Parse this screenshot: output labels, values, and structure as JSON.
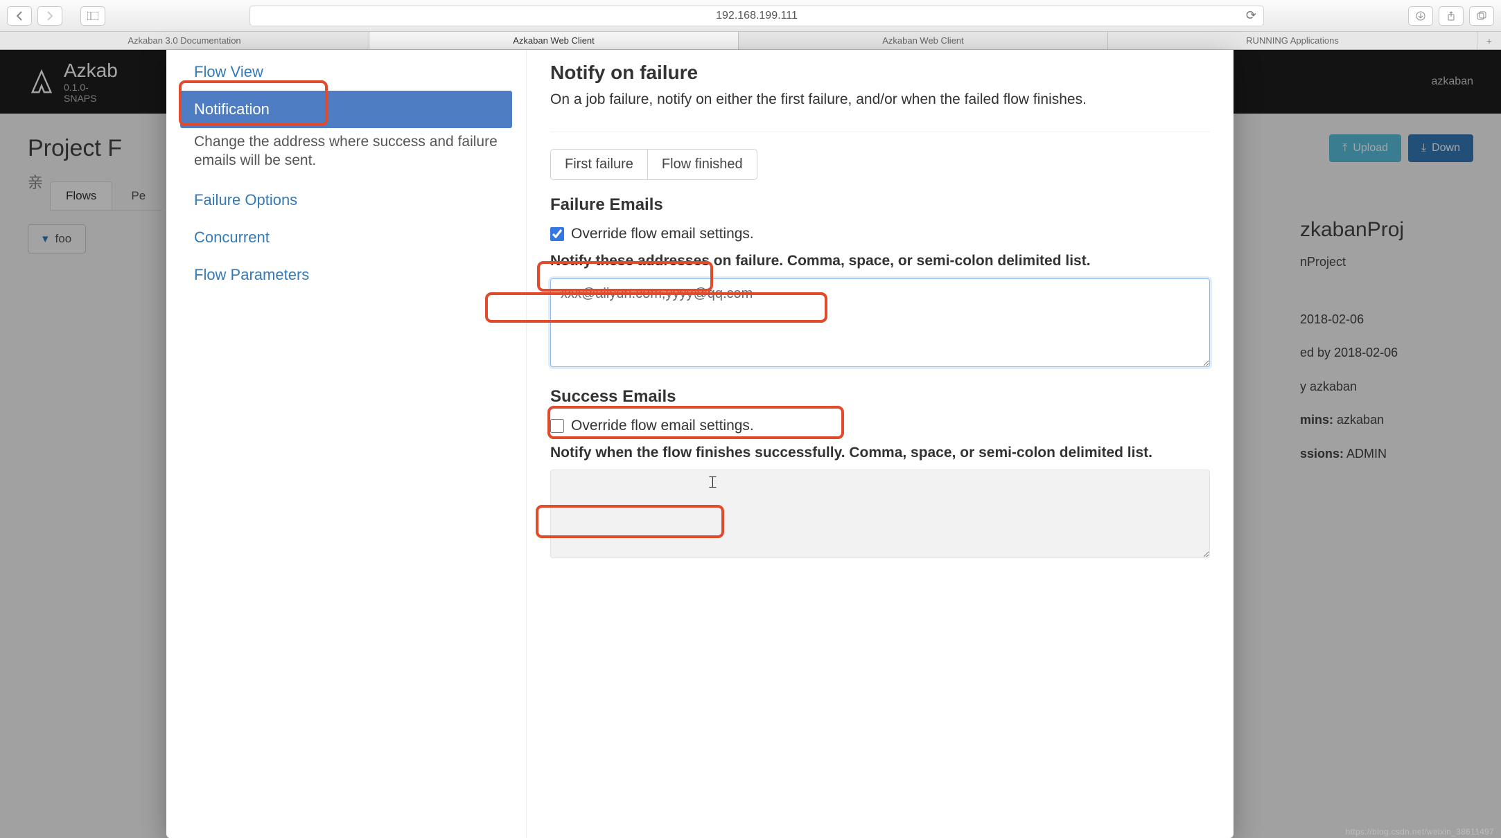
{
  "browser": {
    "url": "192.168.199.111",
    "tabs": [
      "Azkaban 3.0 Documentation",
      "Azkaban Web Client",
      "Azkaban Web Client",
      "RUNNING Applications"
    ],
    "active_tab_index": 1
  },
  "header": {
    "brand": "Azkab",
    "version_line1": "0.1.0-",
    "version_line2": "SNAPS",
    "user": "azkaban"
  },
  "page": {
    "title": "Project F",
    "upload_btn": "Upload",
    "download_btn": "Down",
    "tabs": {
      "flows": "Flows",
      "permissions": "Pe"
    },
    "tabs_sibling_symbol": "亲",
    "flow_btn": "foo"
  },
  "right_meta": {
    "big_line1": "zkabanProj",
    "line2": "nProject",
    "created": "2018-02-06",
    "modified_by_label": "ed by",
    "modified_by_date": "2018-02-06",
    "by_label": "y",
    "by_val": "azkaban",
    "admins_label": "mins:",
    "admins_val": "azkaban",
    "perms_label": "ssions:",
    "perms_val": "ADMIN"
  },
  "modal": {
    "sidebar": {
      "items": [
        "Flow View",
        "Notification",
        "Failure Options",
        "Concurrent",
        "Flow Parameters"
      ],
      "active_index": 1,
      "desc": "Change the address where success and failure emails will be sent."
    },
    "main": {
      "notify_title": "Notify on failure",
      "notify_sub": "On a job failure, notify on either the first failure, and/or when the failed flow finishes.",
      "seg_first": "First failure",
      "seg_finished": "Flow finished",
      "failure_emails_heading": "Failure Emails",
      "override_label": "Override flow email settings.",
      "failure_override_checked": true,
      "failure_notify_desc": "Notify these addresses on failure. Comma, space, or semi-colon delimited list.",
      "failure_emails_value": "xxx@aliyun.com,yyyy@qq.com",
      "success_emails_heading": "Success Emails",
      "success_override_checked": false,
      "success_notify_desc": "Notify when the flow finishes successfully. Comma, space, or semi-colon delimited list.",
      "success_emails_value": ""
    }
  },
  "watermark": "https://blog.csdn.net/weixin_38611497"
}
